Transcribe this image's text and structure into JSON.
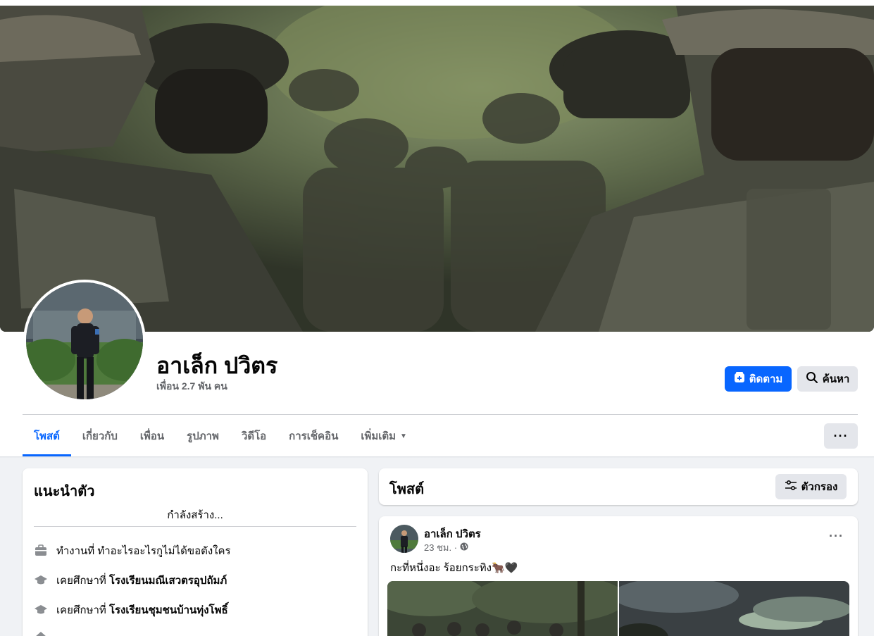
{
  "profile": {
    "name": "อาเล็ก ปวิตร",
    "friends": "เพื่อน 2.7 พัน คน"
  },
  "actions": {
    "follow_label": "ติดตาม",
    "search_label": "ค้นหา",
    "more_label": "···"
  },
  "tabs": [
    {
      "label": "โพสต์"
    },
    {
      "label": "เกี่ยวกับ"
    },
    {
      "label": "เพื่อน"
    },
    {
      "label": "รูปภาพ"
    },
    {
      "label": "วิดีโอ"
    },
    {
      "label": "การเช็คอิน"
    },
    {
      "label": "เพิ่มเติม"
    }
  ],
  "intro": {
    "title": "แนะนำตัว",
    "bio": "กำลังสร้าง...",
    "items": [
      {
        "prefix": "ทำงานที่",
        "value": "ทำอะไรอะไรกูไม่ได้ขอตังใคร",
        "icon": "briefcase-icon"
      },
      {
        "prefix": "เคยศึกษาที่",
        "value": "โรงเรียนมณีเสวตรอุปถัมภ์",
        "icon": "graduation-cap-icon"
      },
      {
        "prefix": "เคยศึกษาที่",
        "value": "โรงเรียนชุมชนบ้านทุ่งโพธิ์",
        "icon": "graduation-cap-icon"
      }
    ]
  },
  "posts": {
    "title": "โพสต์",
    "filter_label": "ตัวกรอง"
  },
  "post": {
    "author": "อาเล็ก ปวิตร",
    "time": "23 ชม. ·",
    "text": "กะที่หนึ่งอะ ร้อยกระทิง🐂🖤"
  },
  "colors": {
    "accent": "#0866ff",
    "bg": "#f0f2f5",
    "secondary_text": "#65676b"
  }
}
